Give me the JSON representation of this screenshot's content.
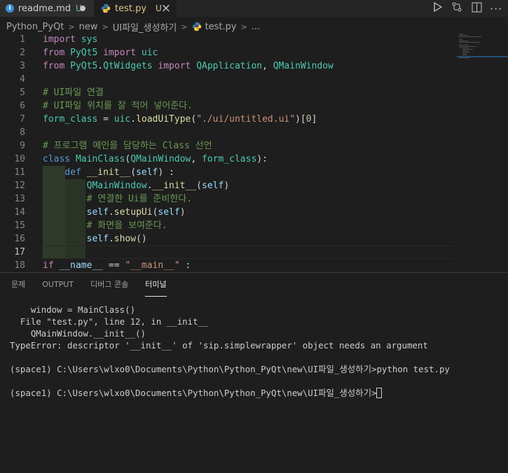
{
  "tabs": [
    {
      "label": "readme.md",
      "status": "U",
      "dirty": true
    },
    {
      "label": "test.py",
      "status": "U",
      "close": "×"
    }
  ],
  "toolbar_actions": [
    "run-icon",
    "compare-changes-icon",
    "split-editor-icon",
    "more-actions-icon"
  ],
  "breadcrumb": [
    "Python_PyQt",
    "new",
    "UI파일_생성하기",
    "test.py",
    "..."
  ],
  "editor": {
    "lines": [
      {
        "n": "1",
        "code": "import sys"
      },
      {
        "n": "2",
        "code": "from PyQt5 import uic"
      },
      {
        "n": "3",
        "code": "from PyQt5.QtWidgets import QApplication, QMainWindow"
      },
      {
        "n": "4",
        "code": ""
      },
      {
        "n": "5",
        "code": "# UI파일 연결"
      },
      {
        "n": "6",
        "code": "# UI파일 위치를 잘 적어 넣어준다."
      },
      {
        "n": "7",
        "code": "form_class = uic.loadUiType(\"./ui/untitled.ui\")[0]"
      },
      {
        "n": "8",
        "code": ""
      },
      {
        "n": "9",
        "code": "# 프로그램 메인을 담당하는 Class 선언"
      },
      {
        "n": "10",
        "code": "class MainClass(QMainWindow, form_class):"
      },
      {
        "n": "11",
        "code": "    def __init__(self) :"
      },
      {
        "n": "12",
        "code": "        QMainWindow.__init__(self)"
      },
      {
        "n": "13",
        "code": "        # 연결한 Ui를 준비한다."
      },
      {
        "n": "14",
        "code": "        self.setupUi(self)"
      },
      {
        "n": "15",
        "code": "        # 화면을 보여준다."
      },
      {
        "n": "16",
        "code": "        self.show()"
      },
      {
        "n": "17",
        "code": ""
      },
      {
        "n": "18",
        "code": "if __name__ == \"__main__\" :"
      }
    ]
  },
  "panel": {
    "tabs": [
      "문제",
      "OUTPUT",
      "디버그 콘솔",
      "터미널"
    ],
    "active_tab": "터미널",
    "terminal_lines": [
      "    window = MainClass()",
      "  File \"test.py\", line 12, in __init__",
      "    QMainWindow.__init__()",
      "TypeError: descriptor '__init__' of 'sip.simplewrapper' object needs an argument",
      "",
      "(space1) C:\\Users\\wlxo0\\Documents\\Python\\Python_PyQt\\new\\UI파일_생성하기>python test.py",
      "",
      "(space1) C:\\Users\\wlxo0\\Documents\\Python\\Python_PyQt\\new\\UI파일_생성하기>"
    ]
  }
}
